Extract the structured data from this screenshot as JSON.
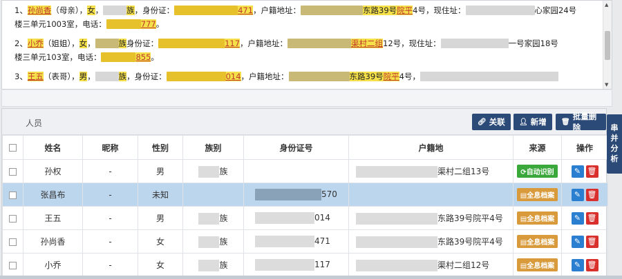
{
  "text_panel": {
    "p1": {
      "num": "1、",
      "name": "孙尚香",
      "relation": "（母亲）",
      "sep1": "，",
      "sex": "女",
      "sep2": "，",
      "ethnic_suffix": "族",
      "id_label": "，身份证：",
      "id_tail": "471",
      "addr_label": "，户籍地址：",
      "addr_mid": "东路39号",
      "addr_tail_hl": "院平",
      "addr_end": "4号，现住址：",
      "cur_tail": "心家园24号",
      "line2a": "楼三单元1003室，电话：",
      "phone_tail": "777",
      "period": "。"
    },
    "p2": {
      "num": "2、",
      "name": "小乔",
      "relation": "（姐姐）",
      "sep1": "，",
      "sex": "女",
      "sep2": "，",
      "ethnic_suffix": "族",
      "id_label": "身份证：",
      "id_tail": "117",
      "addr_label": "，户籍地址：",
      "addr_mid": "渠村二组",
      "addr_end": "12号，现住址：",
      "cur_tail": "一号家园18号",
      "line2a": "楼三单元103室，电话：",
      "phone_tail": "855",
      "period": "。"
    },
    "p3": {
      "num": "3、",
      "name": "王五",
      "relation": "（表哥）",
      "sep1": "，",
      "sex": "男",
      "sep2": "，",
      "ethnic_suffix": "族",
      "id_label": "，身份证：",
      "id_tail": "014",
      "addr_label": "，户籍地址：",
      "addr_mid": "东路39号",
      "addr_tail_hl": "院平",
      "addr_end": "4号，"
    }
  },
  "panel": {
    "title": "人员",
    "buttons": {
      "link": "关联",
      "add": "新增",
      "batch_delete": "批量删除"
    }
  },
  "side_tab": {
    "label": "串并分析"
  },
  "table": {
    "headers": [
      "姓名",
      "昵称",
      "性别",
      "族别",
      "身份证号",
      "户籍地",
      "来源",
      "操作"
    ],
    "rows": [
      {
        "name": "孙权",
        "nickname": "-",
        "gender": "男",
        "ethnic": "族",
        "id_tail": "",
        "addr_tail": "渠村二组13号",
        "source": "自动识别",
        "source_kind": "green",
        "selected": false
      },
      {
        "name": "张昌布",
        "nickname": "-",
        "gender": "未知",
        "ethnic": "",
        "id_tail": "570",
        "addr_tail": "",
        "source": "全息档案",
        "source_kind": "orange",
        "selected": true
      },
      {
        "name": "王五",
        "nickname": "-",
        "gender": "男",
        "ethnic": "族",
        "id_tail": "014",
        "addr_tail": "东路39号院平4号",
        "source": "全息档案",
        "source_kind": "orange",
        "selected": false
      },
      {
        "name": "孙尚香",
        "nickname": "-",
        "gender": "女",
        "ethnic": "族",
        "id_tail": "471",
        "addr_tail": "东路39号院平4号",
        "source": "全息档案",
        "source_kind": "orange",
        "selected": false
      },
      {
        "name": "小乔",
        "nickname": "-",
        "gender": "女",
        "ethnic": "族",
        "id_tail": "117",
        "addr_tail": "渠村二组12号",
        "source": "全息档案",
        "source_kind": "orange",
        "selected": false
      }
    ]
  }
}
